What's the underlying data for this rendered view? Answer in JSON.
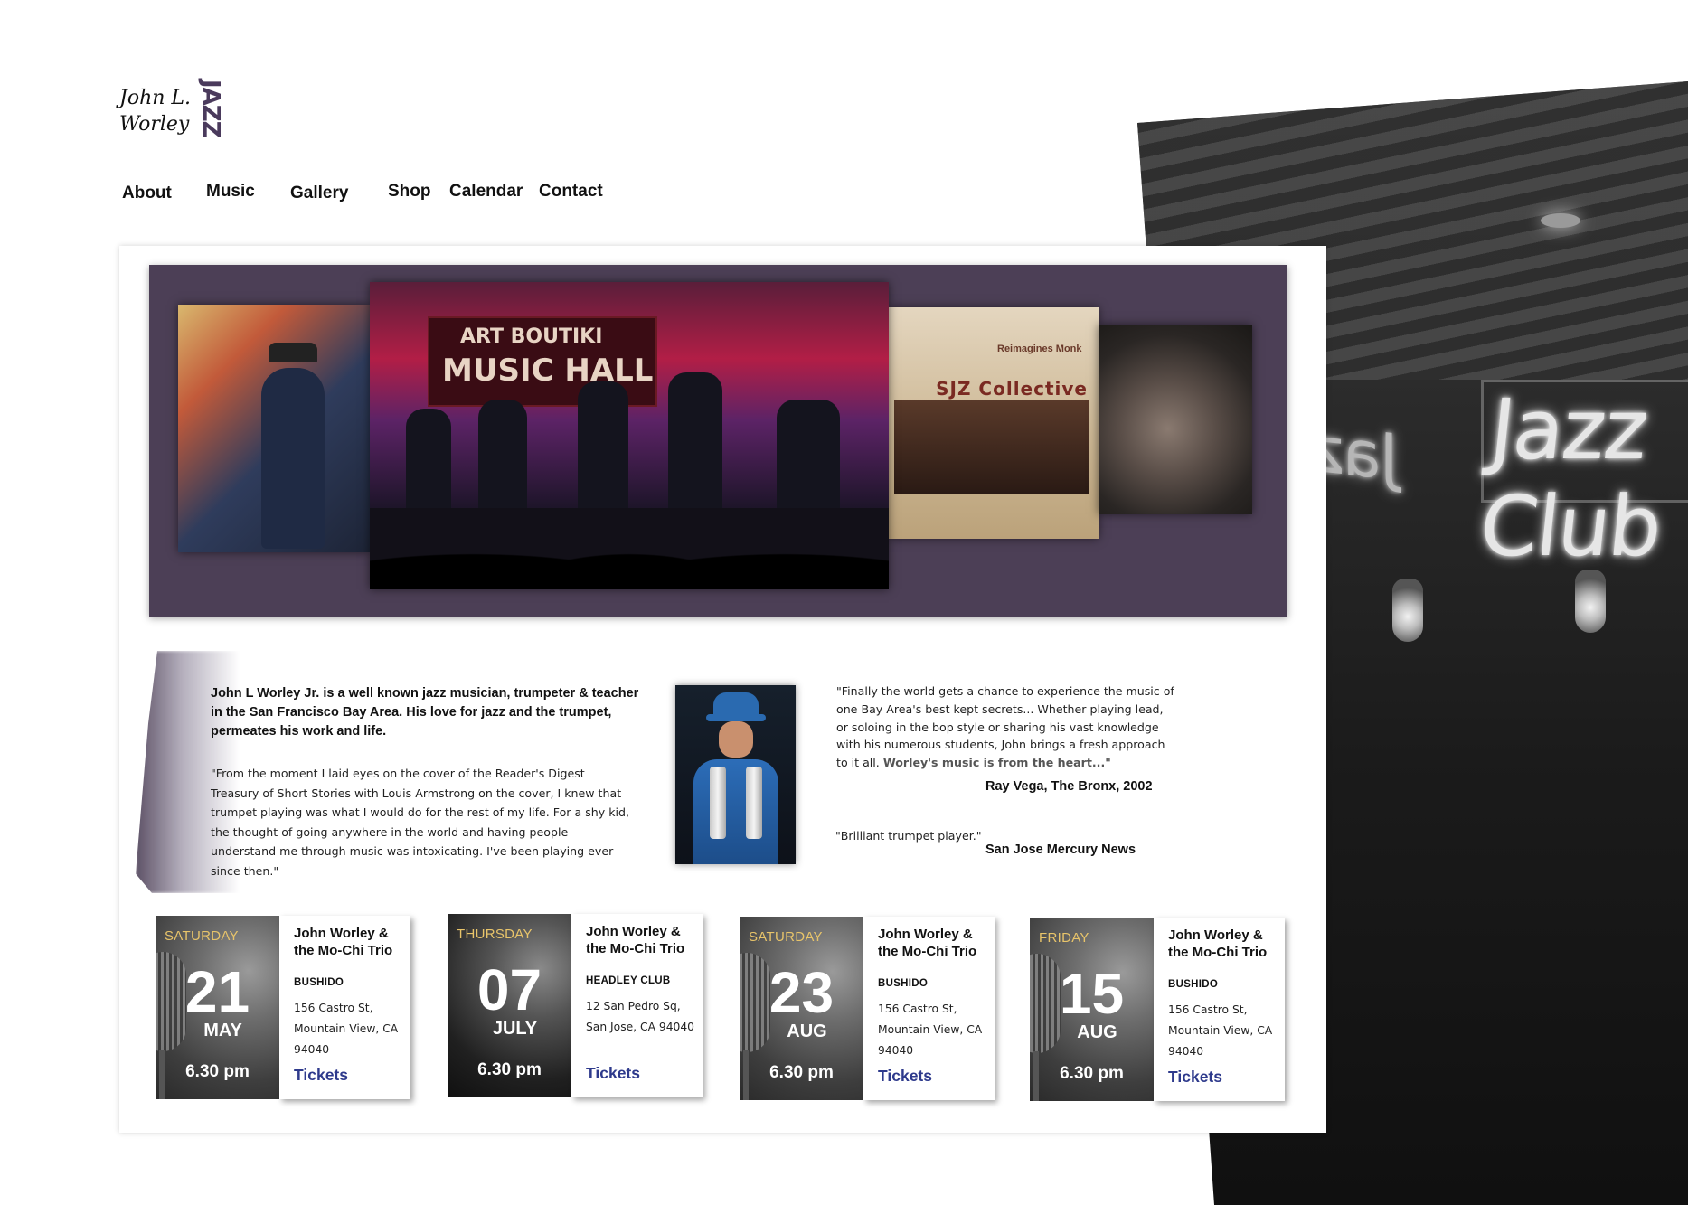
{
  "brand": {
    "script_line1": "John L.",
    "script_line2": "Worley",
    "word": "JAZZ",
    "accent_color": "#4c3f56"
  },
  "nav": {
    "items": [
      "About",
      "Music",
      "Gallery",
      "Shop",
      "Calendar",
      "Contact"
    ]
  },
  "gallery": {
    "photos": [
      "trumpet-performer-photo",
      "music-hall-band-photo",
      "sjz-collective-poster",
      "trumpet-closeup-photo"
    ],
    "poster_title": "Reimagines Monk",
    "poster_heading": "SJZ Collective",
    "banner_line1": "ART BOUTIKI",
    "banner_line2": "MUSIC HALL"
  },
  "background": {
    "neon_sign": "Jazz Club",
    "neon_sign_mirror": "Jazz Club"
  },
  "bio": {
    "lead": "John L Worley Jr. is a well known jazz musician, trumpeter & teacher in the San Francisco Bay Area. His love for jazz and the trumpet, permeates his work and life.",
    "quote": "\"From the moment I laid eyes on the cover of the Reader's Digest Treasury of Short Stories with Louis Armstrong on the cover, I knew that trumpet playing was what I would do for the rest of my life. For a shy kid, the thought of going anywhere in the world and having people understand me through music was intoxicating.  I've been playing ever since then.\""
  },
  "reviews": [
    {
      "text": "\"Finally the world gets a chance to experience the music of one Bay Area's best kept secrets... Whether playing lead, or soloing in the bop style or sharing his vast knowledge with his numerous students, John brings a fresh approach to it all.",
      "emphasis": "Worley's music is from the heart...\"",
      "source": "Ray Vega, The Bronx, 2002"
    },
    {
      "text": "\"Brilliant trumpet player.\"",
      "emphasis": "",
      "source": "San Jose Mercury News"
    }
  ],
  "events": [
    {
      "day": "SATURDAY",
      "date": "21",
      "month": "MAY",
      "time": "6.30 pm",
      "title": "John Worley & the Mo-Chi Trio",
      "venue": "BUSHIDO",
      "address": "156 Castro St, Mountain View, CA 94040",
      "cta": "Tickets"
    },
    {
      "day": "THURSDAY",
      "date": "07",
      "month": "JULY",
      "time": "6.30 pm",
      "title": "John Worley & the Mo-Chi Trio",
      "venue": "HEADLEY CLUB",
      "address": "12 San Pedro Sq, San Jose, CA 94040",
      "cta": "Tickets"
    },
    {
      "day": "SATURDAY",
      "date": "23",
      "month": "AUG",
      "time": "6.30 pm",
      "title": "John Worley & the Mo-Chi Trio",
      "venue": "BUSHIDO",
      "address": "156 Castro St, Mountain View, CA 94040",
      "cta": "Tickets"
    },
    {
      "day": "FRIDAY",
      "date": "15",
      "month": "AUG",
      "time": "6.30 pm",
      "title": "John Worley & the Mo-Chi Trio",
      "venue": "BUSHIDO",
      "address": "156 Castro St, Mountain View, CA 94040",
      "cta": "Tickets"
    }
  ],
  "colors": {
    "gallery_bg": "#4c3f56",
    "day_label": "#e8c46a",
    "tickets_link": "#2e3a8c"
  }
}
